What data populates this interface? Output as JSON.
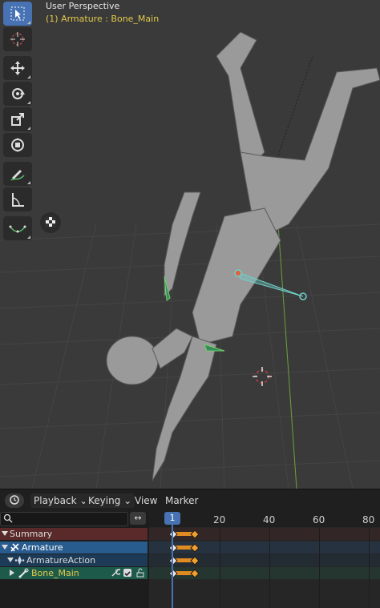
{
  "viewport": {
    "title": "User Perspective",
    "subtitle": "(1) Armature : Bone_Main"
  },
  "toolbar": {
    "tools": [
      {
        "name": "select",
        "icon": "cursor-select-icon",
        "active": true
      },
      {
        "name": "cursor",
        "icon": "3d-cursor-icon"
      },
      {
        "name": "move",
        "icon": "move-arrows-icon"
      },
      {
        "name": "rotate",
        "icon": "rotate-icon"
      },
      {
        "name": "scale",
        "icon": "scale-icon"
      },
      {
        "name": "transform",
        "icon": "transform-icon"
      },
      {
        "name": "annotate",
        "icon": "annotate-pen-icon"
      },
      {
        "name": "measure",
        "icon": "measure-ruler-icon"
      },
      {
        "name": "pose-tools",
        "icon": "pose-curve-icon"
      }
    ],
    "floating_icon": "checker-icon"
  },
  "timeline": {
    "editor_icon": "clock-icon",
    "menus": [
      "Playback",
      "Keying",
      "View",
      "Marker"
    ],
    "current_frame": "1",
    "ruler_labels": [
      "20",
      "40",
      "60",
      "80"
    ],
    "swap_symbol": "↔",
    "channels": [
      {
        "label": "Summary",
        "icon": "triangle-down-icon"
      },
      {
        "label": "Armature",
        "icon": "armature-icon"
      },
      {
        "label": "ArmatureAction",
        "icon": "action-icon"
      },
      {
        "label": "Bone_Main",
        "icon": "bone-icon"
      }
    ]
  }
}
